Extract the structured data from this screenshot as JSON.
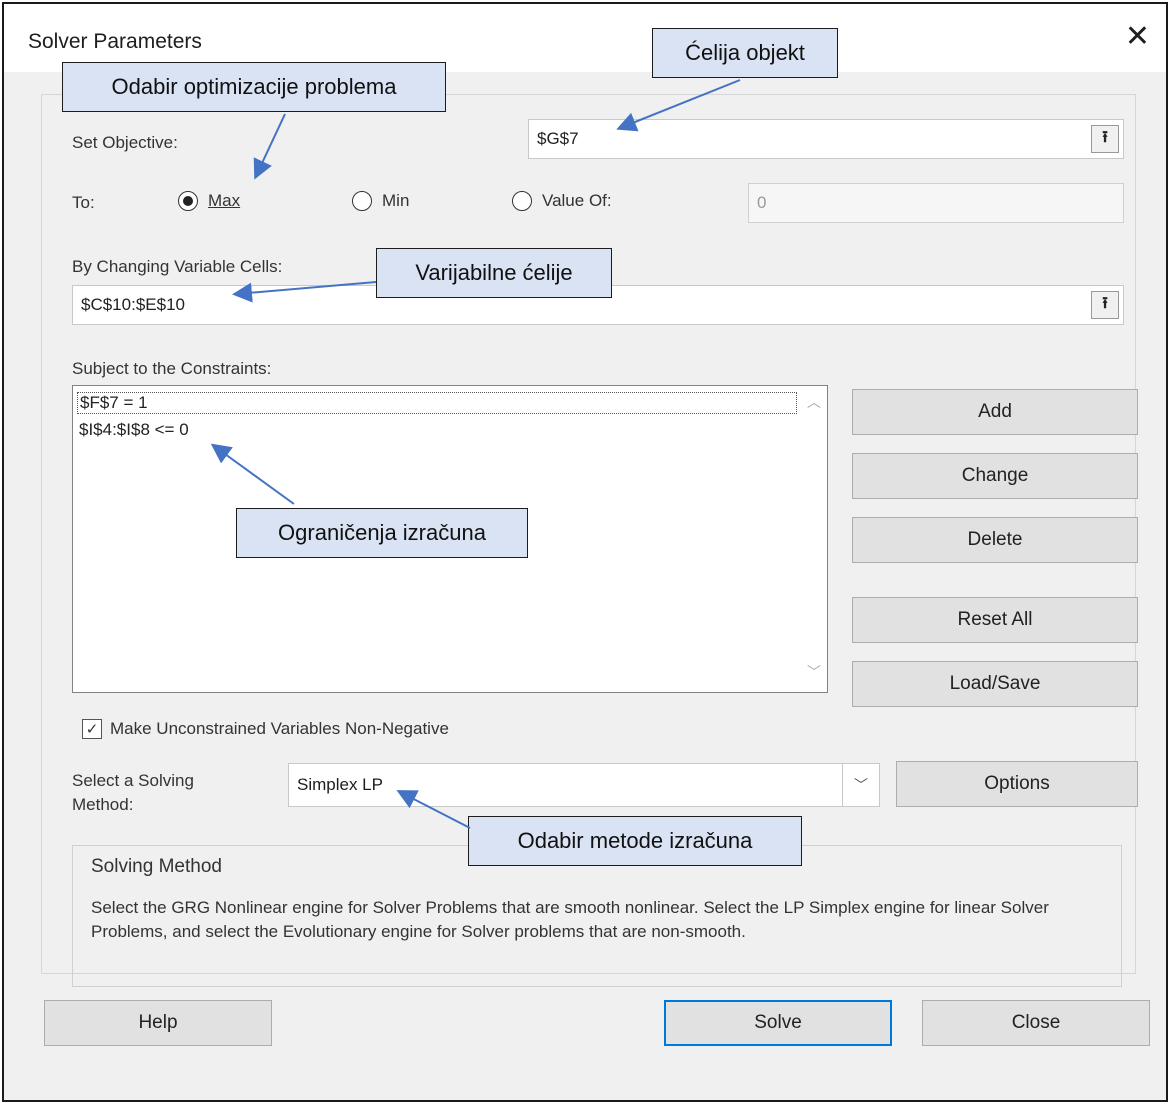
{
  "dialog": {
    "title": "Solver Parameters",
    "close_glyph": "✕"
  },
  "objective": {
    "label": "Set Objective:",
    "value": "$G$7"
  },
  "to": {
    "label": "To:",
    "options": [
      "Max",
      "Min",
      "Value Of:"
    ],
    "selected": "Max",
    "value_of": "0"
  },
  "variables": {
    "label": "By Changing Variable Cells:",
    "value": "$C$10:$E$10"
  },
  "constraints": {
    "label": "Subject to the Constraints:",
    "items": [
      "$F$7 = 1",
      "$I$4:$I$8 <= 0"
    ]
  },
  "buttons": {
    "add": "Add",
    "change": "Change",
    "delete": "Delete",
    "reset_all": "Reset All",
    "load_save": "Load/Save",
    "options": "Options",
    "help": "Help",
    "solve": "Solve",
    "close": "Close"
  },
  "nonnegative": {
    "label": "Make Unconstrained Variables Non-Negative",
    "checked": true
  },
  "method": {
    "label_line1": "Select a Solving",
    "label_line2": "Method:",
    "value": "Simplex LP"
  },
  "solving_method": {
    "title": "Solving Method",
    "description": "Select the GRG Nonlinear engine for Solver Problems that are smooth nonlinear. Select the LP Simplex engine for linear Solver Problems, and select the Evolutionary engine for Solver problems that are non-smooth."
  },
  "callouts": {
    "objective_cell": "Ćelija objekt",
    "optimization": "Odabir optimizacije problema",
    "variable_cells": "Varijabilne ćelije",
    "constraints": "Ograničenja izračuna",
    "method": "Odabir metode izračuna"
  },
  "colors": {
    "callout_bg": "#dae3f3",
    "arrow": "#4472c4",
    "default_button_border": "#0078d7"
  }
}
